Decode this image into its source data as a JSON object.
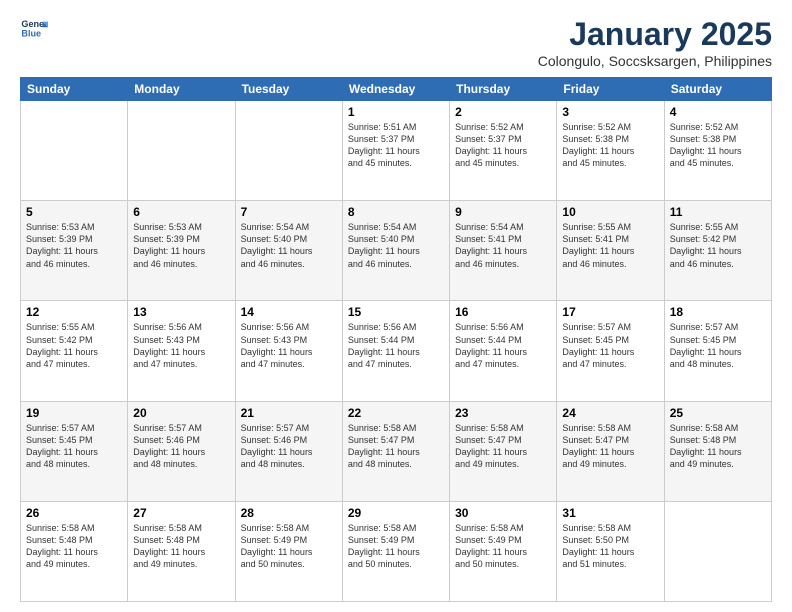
{
  "logo": {
    "line1": "General",
    "line2": "Blue"
  },
  "title": "January 2025",
  "subtitle": "Colongulo, Soccsksargen, Philippines",
  "headers": [
    "Sunday",
    "Monday",
    "Tuesday",
    "Wednesday",
    "Thursday",
    "Friday",
    "Saturday"
  ],
  "weeks": [
    [
      {
        "day": "",
        "info": ""
      },
      {
        "day": "",
        "info": ""
      },
      {
        "day": "",
        "info": ""
      },
      {
        "day": "1",
        "info": "Sunrise: 5:51 AM\nSunset: 5:37 PM\nDaylight: 11 hours\nand 45 minutes."
      },
      {
        "day": "2",
        "info": "Sunrise: 5:52 AM\nSunset: 5:37 PM\nDaylight: 11 hours\nand 45 minutes."
      },
      {
        "day": "3",
        "info": "Sunrise: 5:52 AM\nSunset: 5:38 PM\nDaylight: 11 hours\nand 45 minutes."
      },
      {
        "day": "4",
        "info": "Sunrise: 5:52 AM\nSunset: 5:38 PM\nDaylight: 11 hours\nand 45 minutes."
      }
    ],
    [
      {
        "day": "5",
        "info": "Sunrise: 5:53 AM\nSunset: 5:39 PM\nDaylight: 11 hours\nand 46 minutes."
      },
      {
        "day": "6",
        "info": "Sunrise: 5:53 AM\nSunset: 5:39 PM\nDaylight: 11 hours\nand 46 minutes."
      },
      {
        "day": "7",
        "info": "Sunrise: 5:54 AM\nSunset: 5:40 PM\nDaylight: 11 hours\nand 46 minutes."
      },
      {
        "day": "8",
        "info": "Sunrise: 5:54 AM\nSunset: 5:40 PM\nDaylight: 11 hours\nand 46 minutes."
      },
      {
        "day": "9",
        "info": "Sunrise: 5:54 AM\nSunset: 5:41 PM\nDaylight: 11 hours\nand 46 minutes."
      },
      {
        "day": "10",
        "info": "Sunrise: 5:55 AM\nSunset: 5:41 PM\nDaylight: 11 hours\nand 46 minutes."
      },
      {
        "day": "11",
        "info": "Sunrise: 5:55 AM\nSunset: 5:42 PM\nDaylight: 11 hours\nand 46 minutes."
      }
    ],
    [
      {
        "day": "12",
        "info": "Sunrise: 5:55 AM\nSunset: 5:42 PM\nDaylight: 11 hours\nand 47 minutes."
      },
      {
        "day": "13",
        "info": "Sunrise: 5:56 AM\nSunset: 5:43 PM\nDaylight: 11 hours\nand 47 minutes."
      },
      {
        "day": "14",
        "info": "Sunrise: 5:56 AM\nSunset: 5:43 PM\nDaylight: 11 hours\nand 47 minutes."
      },
      {
        "day": "15",
        "info": "Sunrise: 5:56 AM\nSunset: 5:44 PM\nDaylight: 11 hours\nand 47 minutes."
      },
      {
        "day": "16",
        "info": "Sunrise: 5:56 AM\nSunset: 5:44 PM\nDaylight: 11 hours\nand 47 minutes."
      },
      {
        "day": "17",
        "info": "Sunrise: 5:57 AM\nSunset: 5:45 PM\nDaylight: 11 hours\nand 47 minutes."
      },
      {
        "day": "18",
        "info": "Sunrise: 5:57 AM\nSunset: 5:45 PM\nDaylight: 11 hours\nand 48 minutes."
      }
    ],
    [
      {
        "day": "19",
        "info": "Sunrise: 5:57 AM\nSunset: 5:45 PM\nDaylight: 11 hours\nand 48 minutes."
      },
      {
        "day": "20",
        "info": "Sunrise: 5:57 AM\nSunset: 5:46 PM\nDaylight: 11 hours\nand 48 minutes."
      },
      {
        "day": "21",
        "info": "Sunrise: 5:57 AM\nSunset: 5:46 PM\nDaylight: 11 hours\nand 48 minutes."
      },
      {
        "day": "22",
        "info": "Sunrise: 5:58 AM\nSunset: 5:47 PM\nDaylight: 11 hours\nand 48 minutes."
      },
      {
        "day": "23",
        "info": "Sunrise: 5:58 AM\nSunset: 5:47 PM\nDaylight: 11 hours\nand 49 minutes."
      },
      {
        "day": "24",
        "info": "Sunrise: 5:58 AM\nSunset: 5:47 PM\nDaylight: 11 hours\nand 49 minutes."
      },
      {
        "day": "25",
        "info": "Sunrise: 5:58 AM\nSunset: 5:48 PM\nDaylight: 11 hours\nand 49 minutes."
      }
    ],
    [
      {
        "day": "26",
        "info": "Sunrise: 5:58 AM\nSunset: 5:48 PM\nDaylight: 11 hours\nand 49 minutes."
      },
      {
        "day": "27",
        "info": "Sunrise: 5:58 AM\nSunset: 5:48 PM\nDaylight: 11 hours\nand 49 minutes."
      },
      {
        "day": "28",
        "info": "Sunrise: 5:58 AM\nSunset: 5:49 PM\nDaylight: 11 hours\nand 50 minutes."
      },
      {
        "day": "29",
        "info": "Sunrise: 5:58 AM\nSunset: 5:49 PM\nDaylight: 11 hours\nand 50 minutes."
      },
      {
        "day": "30",
        "info": "Sunrise: 5:58 AM\nSunset: 5:49 PM\nDaylight: 11 hours\nand 50 minutes."
      },
      {
        "day": "31",
        "info": "Sunrise: 5:58 AM\nSunset: 5:50 PM\nDaylight: 11 hours\nand 51 minutes."
      },
      {
        "day": "",
        "info": ""
      }
    ]
  ]
}
